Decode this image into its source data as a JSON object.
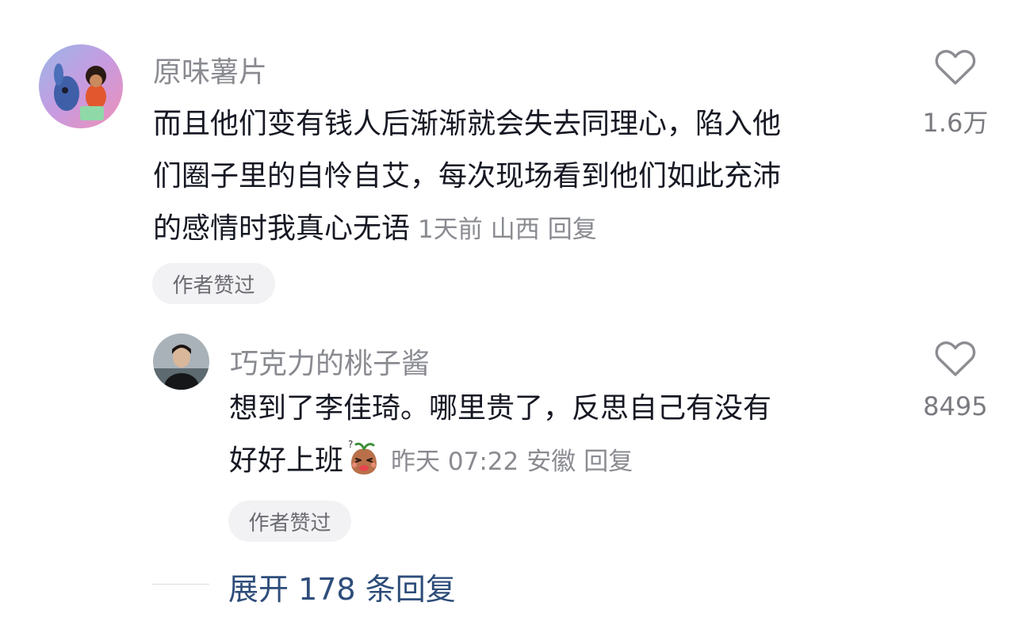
{
  "comments": [
    {
      "username": "原味薯片",
      "lines": [
        "而且他们变有钱人后渐渐就会失去同理心，陷入他",
        "们圈子里的自怜自艾，每次现场看到他们如此充沛",
        "的感情时我真心无语"
      ],
      "time": "1天前",
      "location": "山西",
      "reply_label": "回复",
      "like_count": "1.6万",
      "badge": "作者赞过"
    },
    {
      "username": "巧克力的桃子酱",
      "lines": [
        "想到了李佳琦。哪里贵了，反思自己有没有",
        "好好上班"
      ],
      "time": "昨天 07:22",
      "location": "安徽",
      "reply_label": "回复",
      "like_count": "8495",
      "badge": "作者赞过"
    }
  ],
  "expand_replies": "展开 178 条回复",
  "icons": {
    "like": "heart-outline-icon",
    "emoji": "crying-face-emoji-icon"
  },
  "colors": {
    "username": "#8a8b91",
    "text": "#161823",
    "expand": "#2e4d7a",
    "pill_bg": "#f2f2f4"
  }
}
